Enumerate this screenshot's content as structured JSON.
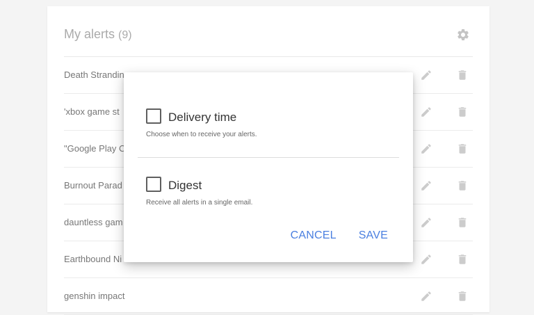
{
  "header": {
    "title": "My alerts",
    "count": "(9)",
    "settings_icon": "gear-icon"
  },
  "alerts": [
    {
      "label": "Death Strandin"
    },
    {
      "label": "'xbox game st"
    },
    {
      "label": "\"Google Play C"
    },
    {
      "label": "Burnout Parad"
    },
    {
      "label": "dauntless gam"
    },
    {
      "label": "Earthbound Ni"
    },
    {
      "label": "genshin impact"
    }
  ],
  "row_icons": {
    "edit": "pencil-icon",
    "delete": "trash-icon"
  },
  "dialog": {
    "delivery": {
      "label": "Delivery time",
      "description": "Choose when to receive your alerts.",
      "checked": false
    },
    "digest": {
      "label": "Digest",
      "description": "Receive all alerts in a single email.",
      "checked": false
    },
    "cancel_label": "CANCEL",
    "save_label": "SAVE"
  },
  "colors": {
    "accent": "#4a7fe0",
    "icon": "#cccccc",
    "background": "#f4f4f4"
  }
}
